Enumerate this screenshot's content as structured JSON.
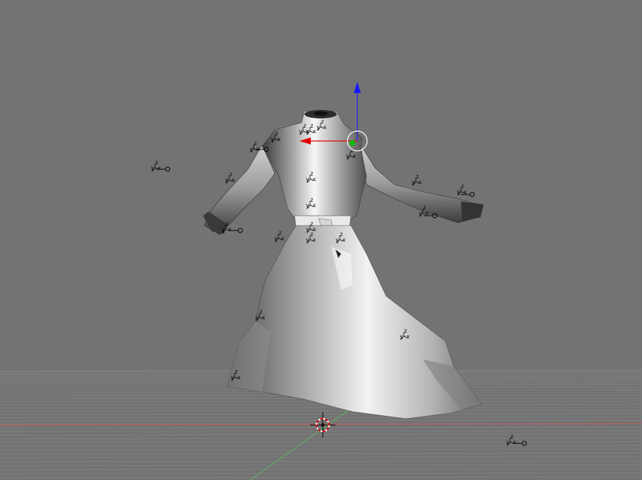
{
  "viewport": {
    "mode": "3D viewport",
    "background_color": "#737373",
    "grid_color": "#8a8a8a",
    "x_axis_color": "#c65a5a",
    "y_axis_color": "#5fb45f",
    "mesh_color": "#cfcfcf",
    "gizmo": {
      "x_color": "#e00000",
      "y_color": "#00c000",
      "z_color": "#1a1aff"
    }
  },
  "objects": {
    "mesh_name": "robe-mesh",
    "empty_label": "y x z",
    "empty_count": 24,
    "lamp_count": 6
  },
  "icons": {
    "cursor": "3d-cursor-icon",
    "transform_gizmo": "transform-gizmo-icon",
    "empty": "empty-axes-icon",
    "lamp": "lamp-icon"
  }
}
